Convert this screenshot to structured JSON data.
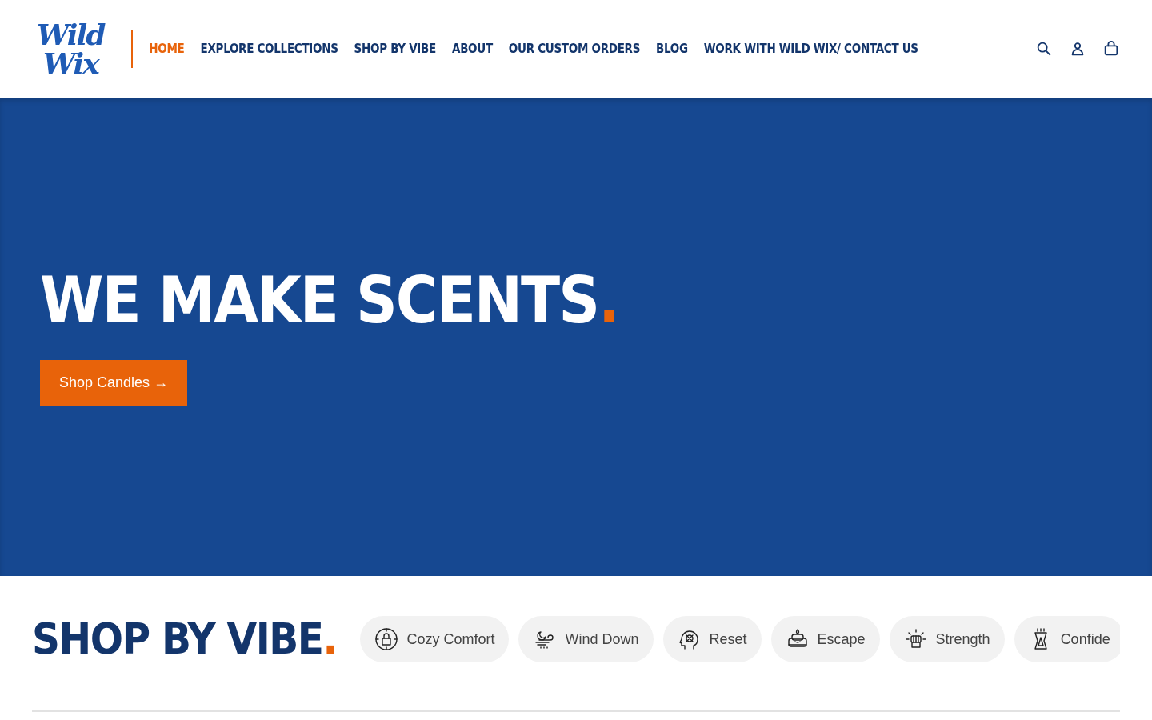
{
  "header": {
    "logo": {
      "lines": [
        "Wild",
        "Wix"
      ]
    },
    "nav": [
      {
        "label": "HOME",
        "selected": true
      },
      {
        "label": "EXPLORE COLLECTIONS",
        "selected": false
      },
      {
        "label": "SHOP BY VIBE",
        "selected": false
      },
      {
        "label": "ABOUT",
        "selected": false
      },
      {
        "label": "OUR CUSTOM ORDERS",
        "selected": false
      },
      {
        "label": "BLOG",
        "selected": false
      },
      {
        "label": "WORK WITH WILD WIX/ CONTACT US",
        "selected": false
      }
    ],
    "actions": [
      {
        "kind": "search"
      },
      {
        "kind": "account"
      },
      {
        "kind": "cart"
      }
    ]
  },
  "hero": {
    "title": "WE MAKE SCENTS",
    "accent": ".",
    "button": "Shop Candles →"
  },
  "vibes": {
    "title": "SHOP BY VIBE",
    "accent": ".",
    "items": [
      {
        "label": "Cozy Comfort",
        "kind": "lock"
      },
      {
        "label": "Wind Down",
        "kind": "moon"
      },
      {
        "label": "Reset",
        "kind": "head"
      },
      {
        "label": "Escape",
        "kind": "candle"
      },
      {
        "label": "Strength",
        "kind": "fist"
      },
      {
        "label": "Confide",
        "kind": "warmer"
      }
    ]
  }
}
